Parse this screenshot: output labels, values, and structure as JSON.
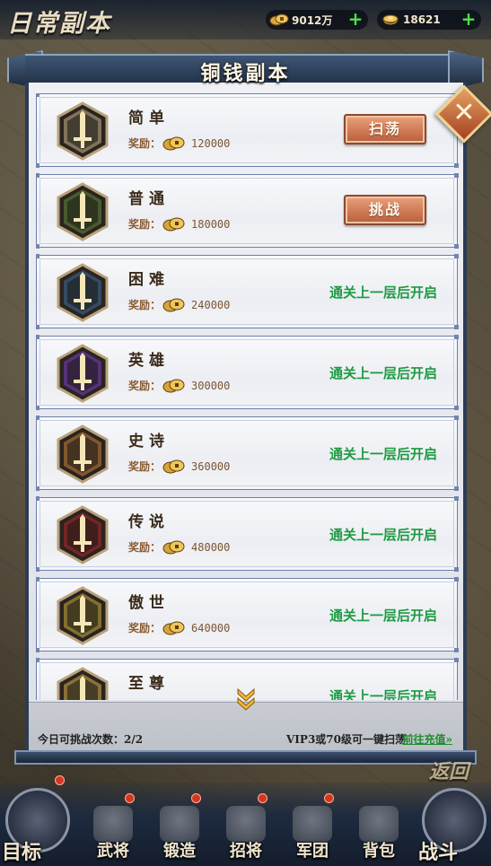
{
  "header": {
    "page_title": "日常副本",
    "coins": "9012万",
    "ingots": "18621",
    "plus": "+"
  },
  "panel": {
    "title": "铜钱副本",
    "close": "✕"
  },
  "dungeons": [
    {
      "name": "简单",
      "reward_label": "奖励：",
      "reward": "120000",
      "action": "扫荡",
      "state": "button",
      "color": "#c9b48a"
    },
    {
      "name": "普通",
      "reward_label": "奖励：",
      "reward": "180000",
      "action": "挑战",
      "state": "button",
      "color": "#5f8a3a"
    },
    {
      "name": "困难",
      "reward_label": "奖励：",
      "reward": "240000",
      "action": "通关上一层后开启",
      "state": "locked",
      "color": "#3d6e9a"
    },
    {
      "name": "英雄",
      "reward_label": "奖励：",
      "reward": "300000",
      "action": "通关上一层后开启",
      "state": "locked",
      "color": "#7b3ec2"
    },
    {
      "name": "史诗",
      "reward_label": "奖励：",
      "reward": "360000",
      "action": "通关上一层后开启",
      "state": "locked",
      "color": "#c6843a"
    },
    {
      "name": "传说",
      "reward_label": "奖励：",
      "reward": "480000",
      "action": "通关上一层后开启",
      "state": "locked",
      "color": "#b3282a"
    },
    {
      "name": "傲世",
      "reward_label": "奖励：",
      "reward": "640000",
      "action": "通关上一层后开启",
      "state": "locked",
      "color": "#c9ae3a"
    },
    {
      "name": "至尊",
      "reward_label": "奖励：",
      "reward": "",
      "action": "通关上一层后开启",
      "state": "locked",
      "color": "#d6b04a"
    }
  ],
  "footer": {
    "attempts": "今日可挑战次数：2/2",
    "vip_note": "VIP3或70级可一键扫荡",
    "recharge": "前往充值»"
  },
  "back": "返回",
  "nav": [
    {
      "label": "目标",
      "badge": true
    },
    {
      "label": "武将",
      "badge": true
    },
    {
      "label": "锻造",
      "badge": true
    },
    {
      "label": "招将",
      "badge": true
    },
    {
      "label": "军团",
      "badge": true
    },
    {
      "label": "背包",
      "badge": false
    },
    {
      "label": "战斗",
      "badge": false
    }
  ]
}
